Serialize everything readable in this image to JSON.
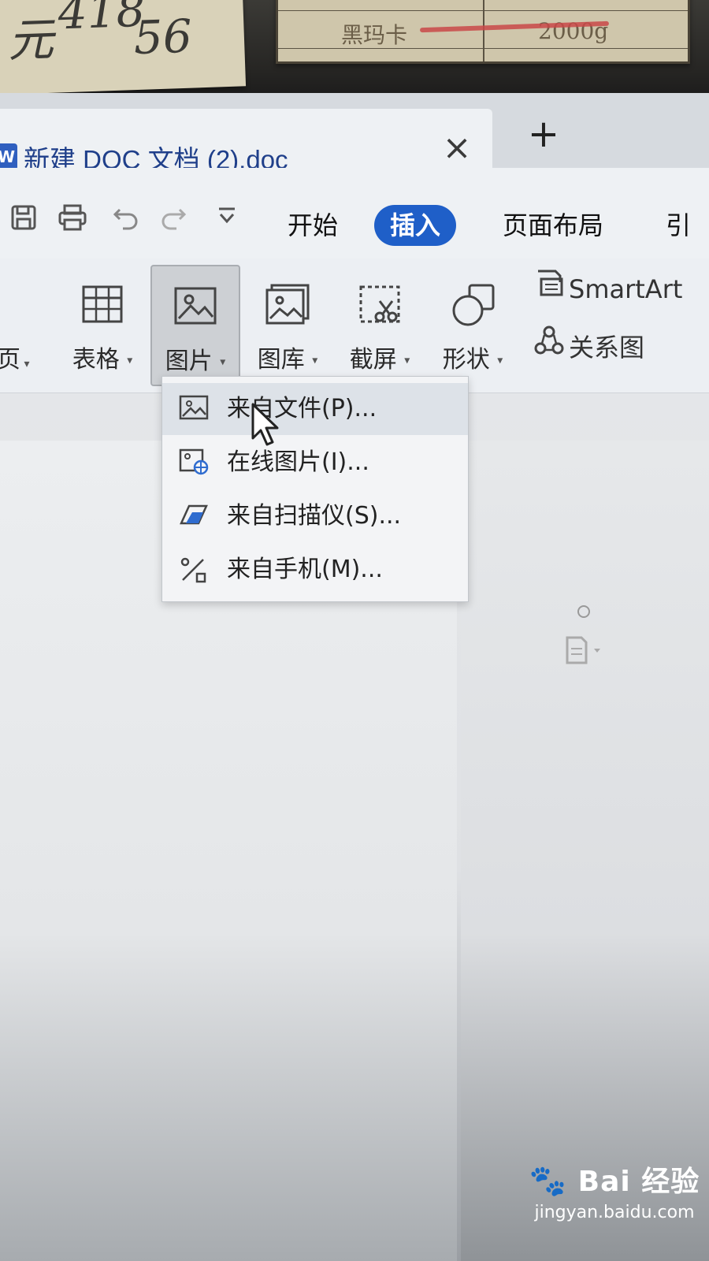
{
  "desk": {
    "note_left_text_1": "元",
    "note_left_text_2": "418",
    "note_left_text_3": "56",
    "note_right_item": "黑玛卡",
    "note_right_value": "2000g"
  },
  "window": {
    "doc_icon": "W",
    "document_title": "新建 DOC 文档 (2).doc",
    "tab_close_icon": "×",
    "new_tab_icon": "+"
  },
  "menubar": {
    "tabs": [
      {
        "label": "开始"
      },
      {
        "label": "插入"
      },
      {
        "label": "页面布局"
      },
      {
        "label": "引"
      }
    ]
  },
  "ribbon": {
    "partial_left_label": "页",
    "buttons": [
      {
        "label": "表格",
        "icon": "table-icon"
      },
      {
        "label": "图片",
        "icon": "picture-icon"
      },
      {
        "label": "图库",
        "icon": "gallery-icon"
      },
      {
        "label": "截屏",
        "icon": "screenshot-icon"
      },
      {
        "label": "形状",
        "icon": "shapes-icon"
      }
    ],
    "smartart_label": "SmartArt",
    "relation_label": "关系图"
  },
  "picture_menu": {
    "items": [
      {
        "label": "来自文件(P)...",
        "icon": "image-file-icon"
      },
      {
        "label": "在线图片(I)...",
        "icon": "online-image-icon"
      },
      {
        "label": "来自扫描仪(S)...",
        "icon": "scanner-icon"
      },
      {
        "label": "来自手机(M)...",
        "icon": "phone-icon"
      }
    ]
  },
  "watermark": {
    "brand": "Bai 经验",
    "url": "jingyan.baidu.com"
  },
  "colors": {
    "accent": "#1f5fc8",
    "title_text": "#1f3f8a"
  }
}
